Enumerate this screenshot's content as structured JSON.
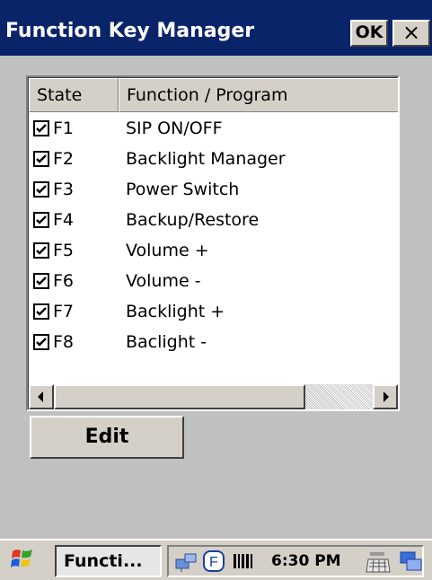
{
  "window": {
    "title": "Function Key Manager",
    "ok_label": "OK",
    "close_label": "×"
  },
  "list": {
    "columns": [
      "State",
      "Function / Program"
    ],
    "rows": [
      {
        "checked": true,
        "key": "F1",
        "function": "SIP ON/OFF"
      },
      {
        "checked": true,
        "key": "F2",
        "function": "Backlight Manager"
      },
      {
        "checked": true,
        "key": "F3",
        "function": "Power Switch"
      },
      {
        "checked": true,
        "key": "F4",
        "function": "Backup/Restore"
      },
      {
        "checked": true,
        "key": "F5",
        "function": "Volume +"
      },
      {
        "checked": true,
        "key": "F6",
        "function": "Volume -"
      },
      {
        "checked": true,
        "key": "F7",
        "function": "Backlight +"
      },
      {
        "checked": true,
        "key": "F8",
        "function": "Baclight -"
      }
    ]
  },
  "edit_button": "Edit",
  "taskbar": {
    "task_label": "Functi...",
    "clock": "6:30 PM",
    "tray_icons": [
      "network-icon",
      "f-key-icon",
      "barcode-icon",
      "keyboard-icon",
      "windows-switch-icon"
    ]
  },
  "colors": {
    "title_bar": "#0a246a",
    "face": "#c0c0c0",
    "button_face": "#d4d0c8"
  }
}
